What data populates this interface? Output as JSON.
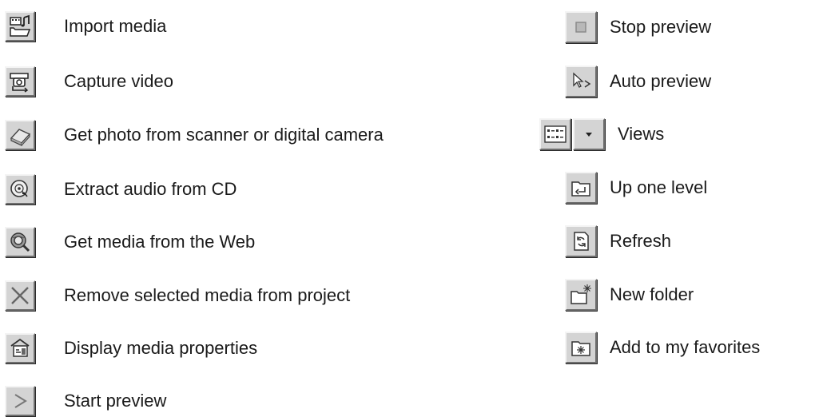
{
  "left_items": [
    {
      "icon": "import-media-icon",
      "label": "Import media"
    },
    {
      "icon": "capture-video-icon",
      "label": "Capture video"
    },
    {
      "icon": "scanner-icon",
      "label": "Get photo from scanner or digital camera"
    },
    {
      "icon": "cd-audio-icon",
      "label": "Extract audio from CD"
    },
    {
      "icon": "web-search-icon",
      "label": "Get media from the Web"
    },
    {
      "icon": "remove-x-icon",
      "label": "Remove selected media from project"
    },
    {
      "icon": "properties-icon",
      "label": "Display media properties"
    },
    {
      "icon": "play-icon",
      "label": "Start preview"
    }
  ],
  "right_items": [
    {
      "icon": "stop-icon",
      "label": "Stop preview"
    },
    {
      "icon": "auto-preview-icon",
      "label": "Auto preview"
    },
    {
      "icon": "views-icon",
      "label": "Views"
    },
    {
      "icon": "up-one-level-icon",
      "label": "Up one level"
    },
    {
      "icon": "refresh-icon",
      "label": "Refresh"
    },
    {
      "icon": "new-folder-icon",
      "label": "New folder"
    },
    {
      "icon": "add-favorites-icon",
      "label": "Add to my favorites"
    }
  ],
  "colors": {
    "button_face": "#d4d4d4",
    "text": "#1a1a1a",
    "background": "#ffffff"
  }
}
